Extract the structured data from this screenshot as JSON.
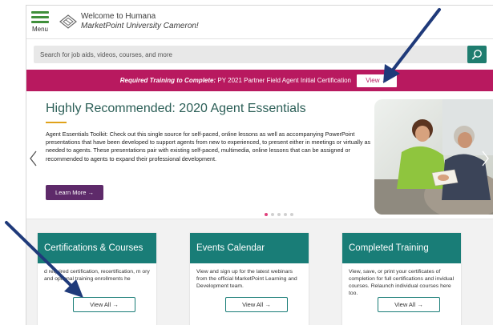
{
  "header": {
    "menu_label": "Menu",
    "welcome_line1": "Welcome to Humana",
    "welcome_line2": "MarketPoint University Cameron!"
  },
  "search": {
    "placeholder": "Search for job aids, videos, courses, and more"
  },
  "banner": {
    "strong_text": "Required Training to Complete:",
    "text": " PY 2021 Partner Field Agent Initial Certification",
    "button_label": "View →"
  },
  "hero": {
    "title": "Highly Recommended: 2020 Agent Essentials",
    "description": "Agent Essentials Toolkit: Check out this single source for self-paced, online lessons as well as accompanying PowerPoint presentations that have been developed to support agents from new to experienced, to present either in meetings or virtually as needed to agents. These presentations pair with existing self-paced, multimedia, online lessons that can be assigned or recommended to agents to expand their professional development.",
    "button_label": "Learn More →",
    "slide_count": 5,
    "active_slide": 1
  },
  "cards": [
    {
      "title": "Certifications & Courses",
      "body": "d required certification, recertification, m      ory and optional training enrollments he",
      "button_label": "View All →"
    },
    {
      "title": "Events Calendar",
      "body": "View and sign up for the latest webinars from the official MarketPoint Learning and Development team.",
      "button_label": "View All →"
    },
    {
      "title": "Completed Training",
      "body": "View, save, or print your certificates of completion for full certifications and invidual courses. Relaunch individual courses here too.",
      "button_label": "View All →"
    }
  ],
  "colors": {
    "brand_green": "#3f8f3a",
    "teal": "#197d77",
    "search_button": "#1f7d6f",
    "banner": "#b8195f",
    "learn_button": "#5e2a6a",
    "title_text": "#2c5f57",
    "accent_rule": "#e0a21a",
    "active_dot": "#e0417c",
    "annotation_arrow": "#1f3a7a"
  },
  "icons": {
    "menu": "hamburger-icon",
    "logo": "humana-logo-icon",
    "search": "search-icon",
    "prev": "chevron-left-icon",
    "next": "chevron-right-icon"
  }
}
